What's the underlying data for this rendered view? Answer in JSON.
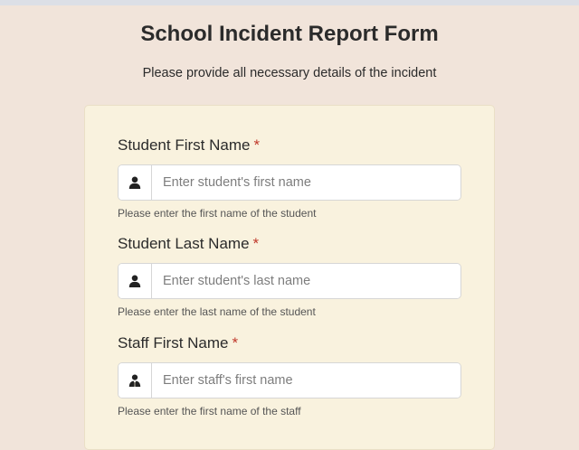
{
  "page": {
    "title": "School Incident Report Form",
    "subtitle": "Please provide all necessary details of the incident"
  },
  "colors": {
    "background": "#f1e4da",
    "card": "#f9f2de",
    "required": "#c0392b"
  },
  "fields": [
    {
      "label": "Student First Name",
      "required_mark": "*",
      "icon": "user-icon",
      "value": "",
      "placeholder": "Enter student's first name",
      "help": "Please enter the first name of the student"
    },
    {
      "label": "Student Last Name",
      "required_mark": "*",
      "icon": "user-icon",
      "value": "",
      "placeholder": "Enter student's last name",
      "help": "Please enter the last name of the student"
    },
    {
      "label": "Staff First Name",
      "required_mark": "*",
      "icon": "user-tie-icon",
      "value": "",
      "placeholder": "Enter staff's first name",
      "help": "Please enter the first name of the staff"
    }
  ]
}
